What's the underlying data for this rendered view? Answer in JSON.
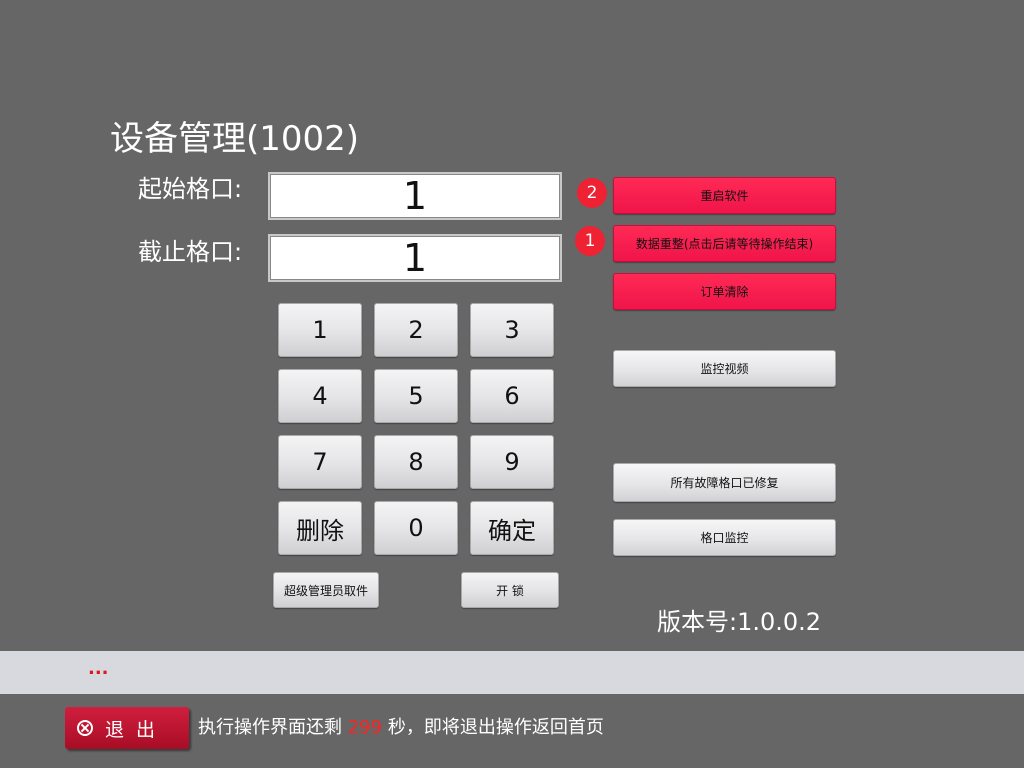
{
  "page": {
    "title": "设备管理(1002)"
  },
  "form": {
    "start_label": "起始格口:",
    "start_value": "1",
    "end_label": "截止格口:",
    "end_value": "1"
  },
  "keypad": {
    "keys": [
      "1",
      "2",
      "3",
      "4",
      "5",
      "6",
      "7",
      "8",
      "9",
      "删除",
      "0",
      "确定"
    ]
  },
  "bottom_actions": {
    "super_admin": "超级管理员取件",
    "unlock": "开 锁"
  },
  "side_actions": {
    "restart": {
      "label": "重启软件",
      "badge": "2"
    },
    "data_reset": {
      "label": "数据重整(点击后请等待操作结束)",
      "badge": "1"
    },
    "clear_orders": {
      "label": "订单清除"
    },
    "monitor_video": {
      "label": "监控视频"
    },
    "faults_fixed": {
      "label": "所有故障格口已修复"
    },
    "slot_monitor": {
      "label": "格口监控"
    }
  },
  "version": "版本号:1.0.0.2",
  "status_bar": {
    "text": "..."
  },
  "footer": {
    "exit_label": "退出",
    "countdown_prefix": "执行操作界面还剩",
    "countdown_seconds": "299",
    "countdown_suffix": "秒，即将退出操作返回首页"
  },
  "colors": {
    "background": "#666666",
    "danger": "#f0144a",
    "badge": "#ee2233",
    "exit": "#b8132e"
  },
  "icons": {
    "exit": "close-circle-icon"
  }
}
